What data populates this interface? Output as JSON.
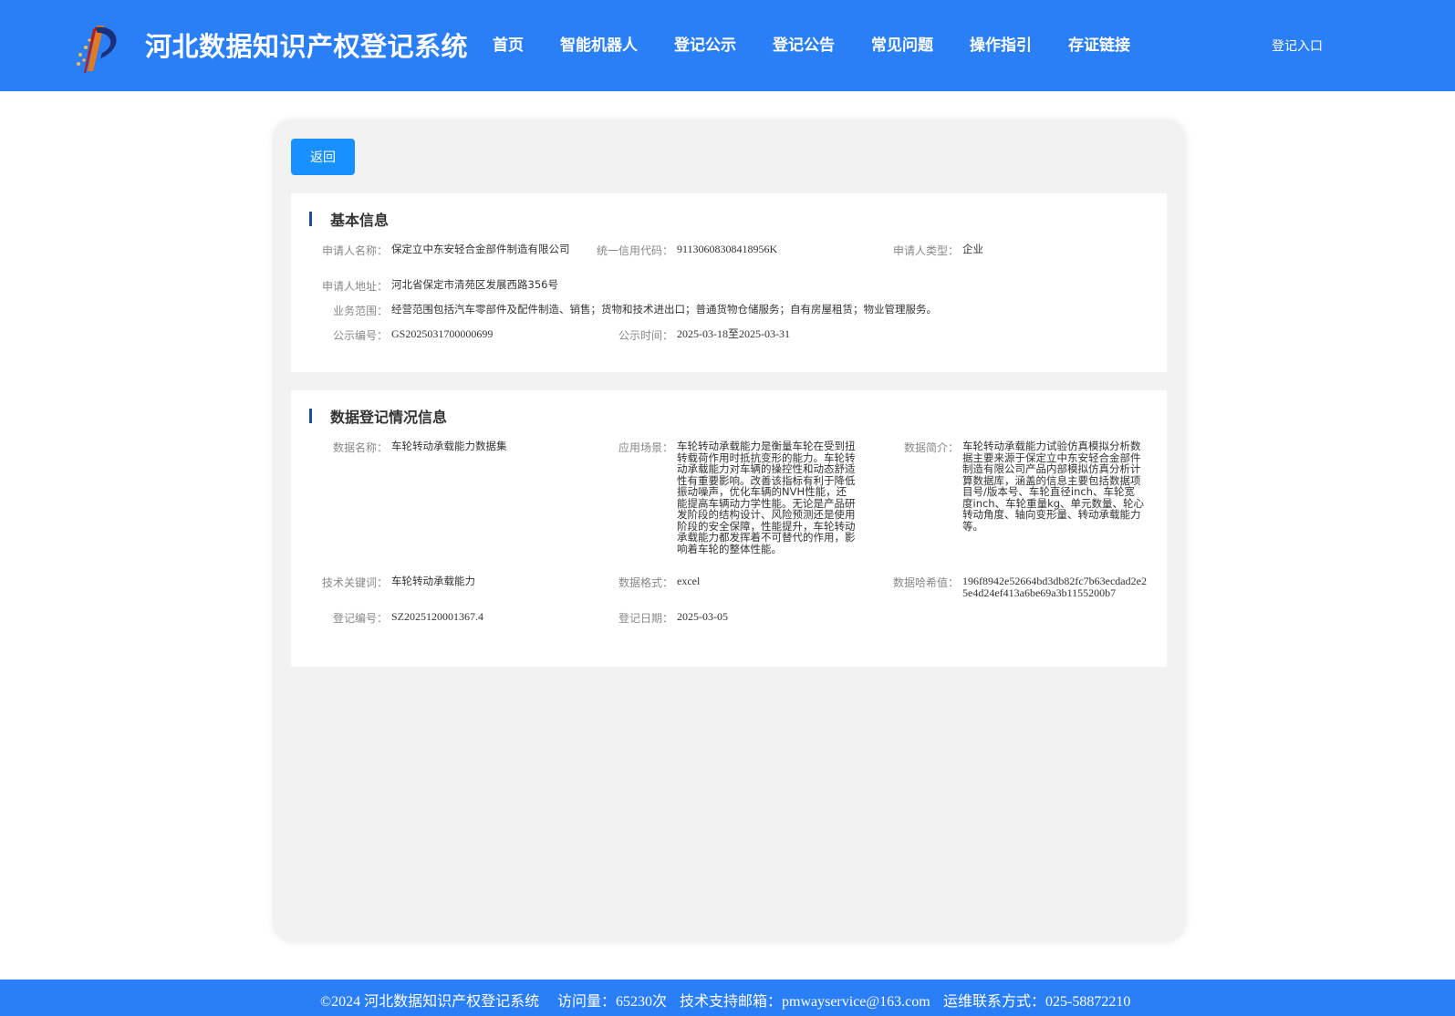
{
  "header": {
    "title": "河北数据知识产权登记系统",
    "nav": [
      {
        "label": "首页"
      },
      {
        "label": "智能机器人"
      },
      {
        "label": "登记公示"
      },
      {
        "label": "登记公告"
      },
      {
        "label": "常见问题"
      },
      {
        "label": "操作指引"
      },
      {
        "label": "存证链接"
      }
    ],
    "login_label": "登记入口"
  },
  "actions": {
    "back_label": "返回"
  },
  "basic_info": {
    "heading": "基本信息",
    "applicant_name": {
      "label": "申请人名称：",
      "value": "保定立中东安轻合金部件制造有限公司"
    },
    "credit_code": {
      "label": "统一信用代码：",
      "value": "91130608308418956K"
    },
    "applicant_type": {
      "label": "申请人类型：",
      "value": "企业"
    },
    "applicant_address": {
      "label": "申请人地址：",
      "value": "河北省保定市清苑区发展西路356号"
    },
    "business_scope": {
      "label": "业务范围：",
      "value": "经营范围包括汽车零部件及配件制造、销售；货物和技术进出口；普通货物仓储服务；自有房屋租赁；物业管理服务。"
    },
    "notice_number": {
      "label": "公示编号：",
      "value": "GS2025031700000699"
    },
    "notice_period": {
      "label": "公示时间：",
      "value": "2025-03-18至2025-03-31"
    }
  },
  "data_registration": {
    "heading": "数据登记情况信息",
    "data_name": {
      "label": "数据名称：",
      "value": "车轮转动承载能力数据集"
    },
    "scenario": {
      "label": "应用场景：",
      "value": "车轮转动承载能力是衡量车轮在受到扭转载荷作用时抵抗变形的能力。车轮转动承载能力对车辆的操控性和动态舒适性有重要影响。改善该指标有利于降低振动噪声，优化车辆的NVH性能，还能提高车辆动力学性能。无论是产品研发阶段的结构设计、风险预测还是使用阶段的安全保障，性能提升，车轮转动承载能力都发挥着不可替代的作用，影响着车轮的整体性能。"
    },
    "summary": {
      "label": "数据简介：",
      "value": "车轮转动承载能力试验仿真模拟分析数据主要来源于保定立中东安轻合金部件制造有限公司产品内部模拟仿真分析计算数据库，涵盖的信息主要包括数据项目号/版本号、车轮直径inch、车轮宽度inch、车轮重量kg、单元数量、轮心转动角度、轴向变形量、转动承载能力等。"
    },
    "keywords": {
      "label": "技术关键词：",
      "value": "车轮转动承载能力"
    },
    "format": {
      "label": "数据格式：",
      "value": "excel"
    },
    "hash": {
      "label": "数据哈希值：",
      "value": "196f8942e52664bd3db82fc7b63ecdad2e25e4d24ef413a6be69a3b1155200b7"
    },
    "reg_number": {
      "label": "登记编号：",
      "value": "SZ2025120001367.4"
    },
    "reg_date": {
      "label": "登记日期：",
      "value": "2025-03-05"
    }
  },
  "footer": {
    "copyright": "©2024 河北数据知识产权登记系统",
    "visits": "访问量：65230次",
    "support_email": "技术支持邮箱：pmwayservice@163.com",
    "ops_contact": "运维联系方式：025-58872210"
  },
  "colors": {
    "header_bg": "#2a7ef6",
    "button_bg": "#1890ff",
    "card_bg": "#f2f2f2",
    "heading_bar": "#1f4ea3"
  }
}
